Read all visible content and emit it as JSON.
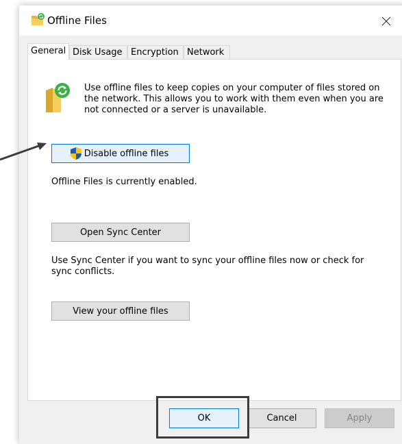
{
  "window": {
    "title": "Offline Files",
    "title_icon": "offline-files-folder-icon",
    "close_icon": "close-icon"
  },
  "tabs": [
    {
      "label": "General",
      "active": true
    },
    {
      "label": "Disk Usage",
      "active": false
    },
    {
      "label": "Encryption",
      "active": false
    },
    {
      "label": "Network",
      "active": false
    }
  ],
  "general": {
    "description": "Use offline files to keep copies on your computer of files stored on the network.  This allows you to work with them even when you are not connected or a server is unavailable.",
    "disable_button": "Disable offline files",
    "status": "Offline Files is currently enabled.",
    "sync_center_button": "Open Sync Center",
    "sync_description": "Use Sync Center if you want to sync your offline files now or check for sync conflicts.",
    "view_files_button": "View your offline files"
  },
  "footer": {
    "ok": "OK",
    "cancel": "Cancel",
    "apply": "Apply"
  },
  "colors": {
    "focus_border": "#0078d7",
    "sync_green": "#3cb043",
    "folder_yellow": "#f2c94c",
    "shield_blue": "#1e5ab4",
    "shield_yellow": "#f5c518",
    "annotation_dark": "#3c3c3c"
  }
}
